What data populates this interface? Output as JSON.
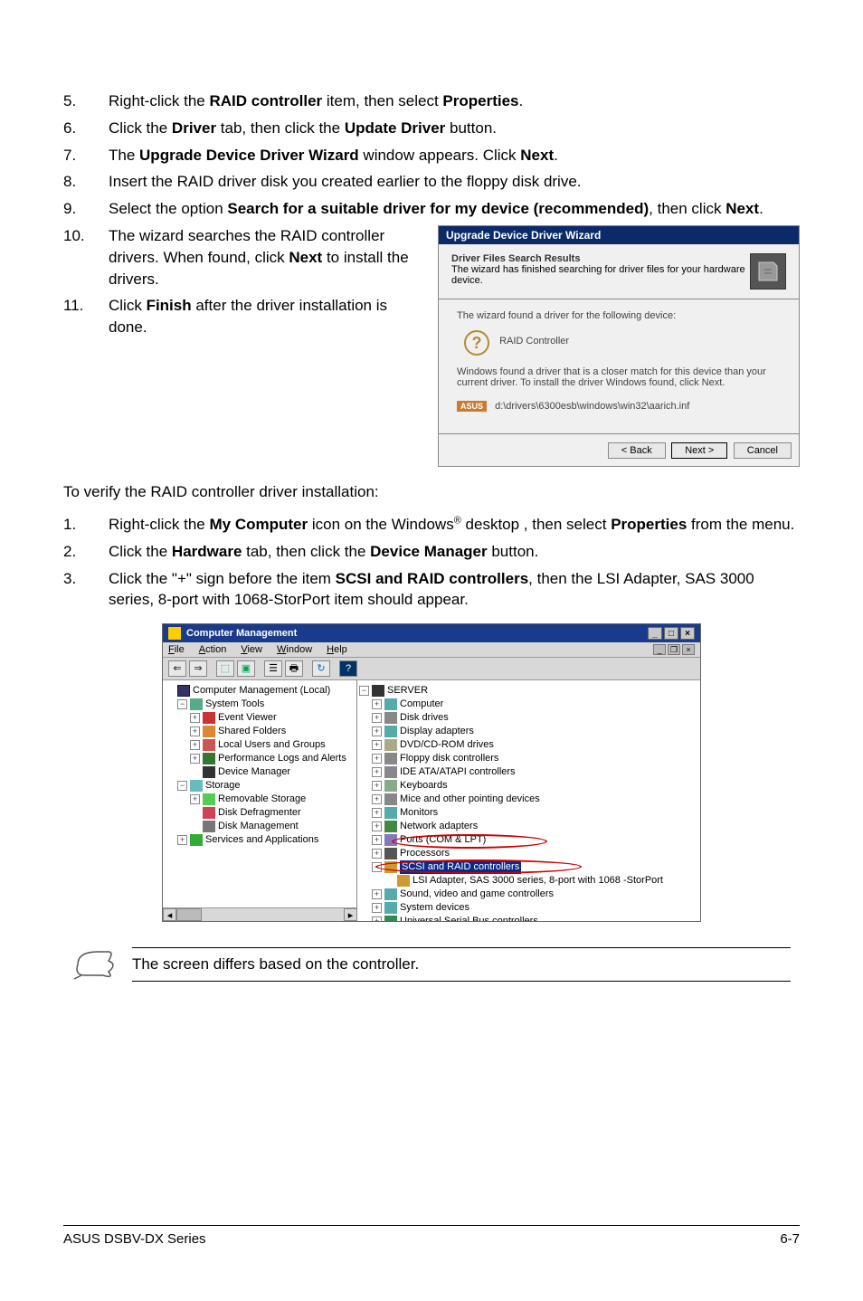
{
  "steps_a": [
    {
      "num": "5.",
      "html": "Right-click the <b>RAID controller</b> item, then select <b>Properties</b>."
    },
    {
      "num": "6.",
      "html": "Click the <b>Driver</b> tab, then click the <b>Update Driver</b> button."
    },
    {
      "num": "7.",
      "html": "The <b>Upgrade Device Driver Wizard</b> window appears. Click <b>Next</b>."
    },
    {
      "num": "8.",
      "html": "Insert the RAID driver disk you created earlier to the floppy disk drive."
    },
    {
      "num": "9.",
      "html": "Select the option <b>Search for a suitable driver for my device (recommended)</b>, then click <b>Next</b>."
    }
  ],
  "step10": {
    "num": "10.",
    "html": "The wizard searches the RAID controller drivers. When found, click <b>Next</b> to install the drivers."
  },
  "step11": {
    "num": "11.",
    "html": "Click <b>Finish</b> after the driver installation is done."
  },
  "wizard": {
    "title": "Upgrade Device Driver Wizard",
    "h1": "Driver Files Search Results",
    "h2": "The wizard has finished searching for driver files for your hardware device.",
    "found": "The wizard found a driver for the following device:",
    "controller": "RAID Controller",
    "closer": "Windows found a driver that is a closer match for this device than your current driver. To install the driver Windows found, click Next.",
    "asus": "ASUS",
    "path": "d:\\drivers\\6300esb\\windows\\win32\\aarich.inf",
    "back": "< Back",
    "next": "Next >",
    "cancel": "Cancel"
  },
  "verify": "To verify the RAID controller driver installation:",
  "steps_b": [
    {
      "num": "1.",
      "html": "Right-click the <b>My Computer</b> icon on the Windows<span class='sup'>®</span> desktop , then select <b>Properties</b> from the menu."
    },
    {
      "num": "2.",
      "html": "Click the <b>Hardware</b> tab, then click the <b>Device Manager</b> button."
    },
    {
      "num": "3.",
      "html": "Click the \"+\" sign before the item <b>SCSI and RAID controllers</b>, then the LSI Adapter, SAS 3000 series, 8-port with 1068-StorPort item should appear."
    }
  ],
  "compmgmt": {
    "title": "Computer Management",
    "menus": [
      "File",
      "Action",
      "View",
      "Window",
      "Help"
    ],
    "left_tree": [
      {
        "ind": 0,
        "exp": "",
        "ic": "ic-monitor",
        "label": "Computer Management (Local)"
      },
      {
        "ind": 1,
        "exp": "−",
        "ic": "ic-comp",
        "label": "System Tools"
      },
      {
        "ind": 2,
        "exp": "+",
        "ic": "ic-book",
        "label": "Event Viewer"
      },
      {
        "ind": 2,
        "exp": "+",
        "ic": "ic-folder",
        "label": "Shared Folders"
      },
      {
        "ind": 2,
        "exp": "+",
        "ic": "ic-users",
        "label": "Local Users and Groups"
      },
      {
        "ind": 2,
        "exp": "+",
        "ic": "ic-perf",
        "label": "Performance Logs and Alerts"
      },
      {
        "ind": 2,
        "exp": "",
        "ic": "ic-dev",
        "label": "Device Manager"
      },
      {
        "ind": 1,
        "exp": "−",
        "ic": "ic-disk",
        "label": "Storage"
      },
      {
        "ind": 2,
        "exp": "+",
        "ic": "ic-rem",
        "label": "Removable Storage"
      },
      {
        "ind": 2,
        "exp": "",
        "ic": "ic-defrag",
        "label": "Disk Defragmenter"
      },
      {
        "ind": 2,
        "exp": "",
        "ic": "ic-dm",
        "label": "Disk Management"
      },
      {
        "ind": 1,
        "exp": "+",
        "ic": "ic-svc",
        "label": "Services and Applications"
      }
    ],
    "right_tree": [
      {
        "ind": 0,
        "exp": "−",
        "ic": "ic-server",
        "label": "SERVER"
      },
      {
        "ind": 1,
        "exp": "+",
        "ic": "ic-hw",
        "label": "Computer"
      },
      {
        "ind": 1,
        "exp": "+",
        "ic": "ic-drive",
        "label": "Disk drives"
      },
      {
        "ind": 1,
        "exp": "+",
        "ic": "ic-disp",
        "label": "Display adapters"
      },
      {
        "ind": 1,
        "exp": "+",
        "ic": "ic-cd",
        "label": "DVD/CD-ROM drives"
      },
      {
        "ind": 1,
        "exp": "+",
        "ic": "ic-fd",
        "label": "Floppy disk controllers"
      },
      {
        "ind": 1,
        "exp": "+",
        "ic": "ic-ide",
        "label": "IDE ATA/ATAPI controllers"
      },
      {
        "ind": 1,
        "exp": "+",
        "ic": "ic-kb",
        "label": "Keyboards"
      },
      {
        "ind": 1,
        "exp": "+",
        "ic": "ic-mouse",
        "label": "Mice and other pointing devices"
      },
      {
        "ind": 1,
        "exp": "+",
        "ic": "ic-mon",
        "label": "Monitors"
      },
      {
        "ind": 1,
        "exp": "+",
        "ic": "ic-net",
        "label": "Network adapters"
      },
      {
        "ind": 1,
        "exp": "+",
        "ic": "ic-port",
        "label": "Ports (COM & LPT)"
      },
      {
        "ind": 1,
        "exp": "+",
        "ic": "ic-proc",
        "label": "Processors"
      },
      {
        "ind": 1,
        "exp": "−",
        "ic": "ic-scsi",
        "label": "SCSI and RAID controllers",
        "sel": true
      },
      {
        "ind": 2,
        "exp": "",
        "ic": "ic-lsi",
        "label": "LSI Adapter, SAS 3000 series, 8-port with 1068 -StorPort"
      },
      {
        "ind": 1,
        "exp": "+",
        "ic": "ic-snd",
        "label": "Sound, video and game controllers"
      },
      {
        "ind": 1,
        "exp": "+",
        "ic": "ic-sys",
        "label": "System devices"
      },
      {
        "ind": 1,
        "exp": "+",
        "ic": "ic-usb",
        "label": "Universal Serial Bus controllers"
      }
    ]
  },
  "note": "The screen differs based on the controller.",
  "footer_left": "ASUS DSBV-DX Series",
  "footer_right": "6-7"
}
